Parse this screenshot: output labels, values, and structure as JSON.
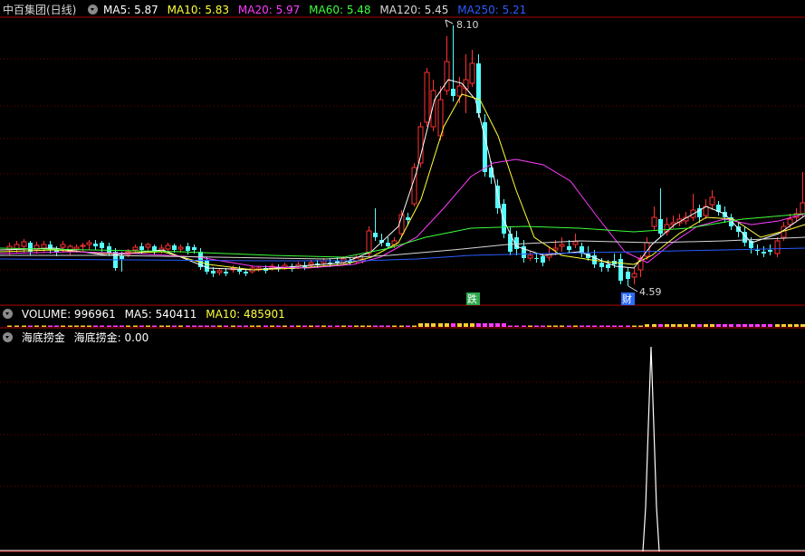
{
  "stock": {
    "title": "中百集团(日线)"
  },
  "ma_legend": [
    {
      "label": "MA5: 5.87",
      "color": "#ffffff"
    },
    {
      "label": "MA10: 5.83",
      "color": "#ffff3a"
    },
    {
      "label": "MA20: 5.97",
      "color": "#ff3cff"
    },
    {
      "label": "MA60: 5.48",
      "color": "#3cff3c"
    },
    {
      "label": "MA120: 5.45",
      "color": "#d8d8d8"
    },
    {
      "label": "MA250: 5.21",
      "color": "#2a5cff"
    }
  ],
  "price_marks": {
    "high": "8.10",
    "low": "4.59"
  },
  "signals": {
    "fall": "跌",
    "cai": "财"
  },
  "volume_legend": {
    "volume": "VOLUME: 996961",
    "ma5": "MA5: 540411",
    "ma10": "MA10: 485901"
  },
  "indicator_legend": {
    "name": "海底捞金",
    "value_label": "海底捞金: 0.00"
  },
  "colors": {
    "up": "#ff3232",
    "down": "#54ffff",
    "divider": "#b00000",
    "grid": "#7a0000"
  }
}
